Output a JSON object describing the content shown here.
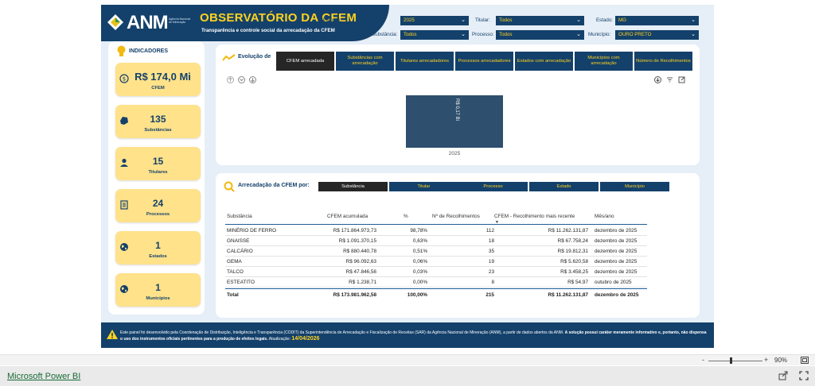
{
  "header": {
    "logo_text": "ANM",
    "logo_sub": "Agência Nacional de Mineração",
    "title": "OBSERVATÓRIO DA CFEM",
    "subtitle": "Transparência e controle social da arrecadação da CFEM"
  },
  "filters": {
    "periodo": {
      "label": "Período:",
      "value": "2025"
    },
    "titular": {
      "label": "Titular:",
      "value": "Todos"
    },
    "estado": {
      "label": "Estado:",
      "value": "MG"
    },
    "substancia": {
      "label": "Substância:",
      "value": "Todos"
    },
    "processo": {
      "label": "Processo:",
      "value": "Todos"
    },
    "municipio": {
      "label": "Município:",
      "value": "OURO PRETO"
    }
  },
  "indicators": {
    "title": "INDICADORES",
    "cards": [
      {
        "value": "R$ 174,0 Mi",
        "label": "CFEM",
        "icon": "dollar-coin-icon"
      },
      {
        "value": "135",
        "label": "Substâncias",
        "icon": "mineral-rock-icon"
      },
      {
        "value": "15",
        "label": "Titulares",
        "icon": "user-icon"
      },
      {
        "value": "24",
        "label": "Processos",
        "icon": "document-icon"
      },
      {
        "value": "1",
        "label": "Estados",
        "icon": "globe-icon"
      },
      {
        "value": "1",
        "label": "Municípios",
        "icon": "globe-icon"
      }
    ]
  },
  "evolution": {
    "title": "Evolução de",
    "tabs": [
      "CFEM arrecadada",
      "Substâncias com arrecadação",
      "Titulares arrecadadores",
      "Processos arrecadadores",
      "Estados com arrecadação",
      "Municípios com arrecadação",
      "Número de Recolhimentos"
    ],
    "active_tab": 0
  },
  "chart_data": {
    "type": "bar",
    "categories": [
      "2025"
    ],
    "values": [
      174.0
    ],
    "data_labels": [
      "R$ 0,17 Bi"
    ],
    "title": "",
    "xlabel": "",
    "ylabel": "",
    "color": "#2e4f6e"
  },
  "arrecadacao": {
    "title": "Arrecadação da CFEM por:",
    "tabs": [
      "Substância",
      "Titular",
      "Processo",
      "Estado",
      "Município"
    ],
    "active_tab": 0,
    "columns": [
      "Substância",
      "CFEM acumulada",
      "%",
      "Nº de Recolhimentos",
      "CFEM - Recolhimento mais recente",
      "Mês/ano"
    ],
    "rows": [
      [
        "MINÉRIO DE FERRO",
        "R$ 171.864.973,73",
        "98,78%",
        "112",
        "R$ 11.262.131,87",
        "dezembro de 2025"
      ],
      [
        "GNAISSE",
        "R$ 1.091.370,15",
        "0,63%",
        "18",
        "R$ 67.758,24",
        "dezembro de 2025"
      ],
      [
        "CALCÁRIO",
        "R$ 880.440,78",
        "0,51%",
        "35",
        "R$ 19.812,31",
        "dezembro de 2025"
      ],
      [
        "GEMA",
        "R$ 96.092,63",
        "0,06%",
        "19",
        "R$ 5.620,58",
        "dezembro de 2025"
      ],
      [
        "TALCO",
        "R$ 47.846,58",
        "0,03%",
        "23",
        "R$ 3.458,25",
        "dezembro de 2025"
      ],
      [
        "ESTEATITO",
        "R$ 1.238,71",
        "0,00%",
        "8",
        "R$ 54,97",
        "outubro de 2025"
      ]
    ],
    "total": [
      "Total",
      "R$ 173.981.962,58",
      "100,00%",
      "215",
      "R$ 11.262.131,87",
      "dezembro de 2025"
    ]
  },
  "footer": {
    "text_1": "Este painel foi desenvolvido pela Coordenação de Distribuição, Inteligência e Transparência (CODIT) da Superintendência de Arrecadação e Fiscalização de Receitas (SAR) da Agência Nacional de Mineração (ANM), a partir de dados abertos da ANM.",
    "text_bold": "A solução possui caráter meramente informativo e, portanto, não dispensa o uso dos instrumentos oficiais pertinentes para a produção de efeitos legais.",
    "update_label": "Atualização:",
    "update_date": "14/04/2026"
  },
  "bottom": {
    "zoom": "90%",
    "app_link": "Microsoft Power BI"
  },
  "colors": {
    "navy": "#14416b",
    "yellow": "#ffd21f",
    "card": "#ffe28a",
    "bar": "#2e4f6e",
    "background": "#e6eef7"
  }
}
